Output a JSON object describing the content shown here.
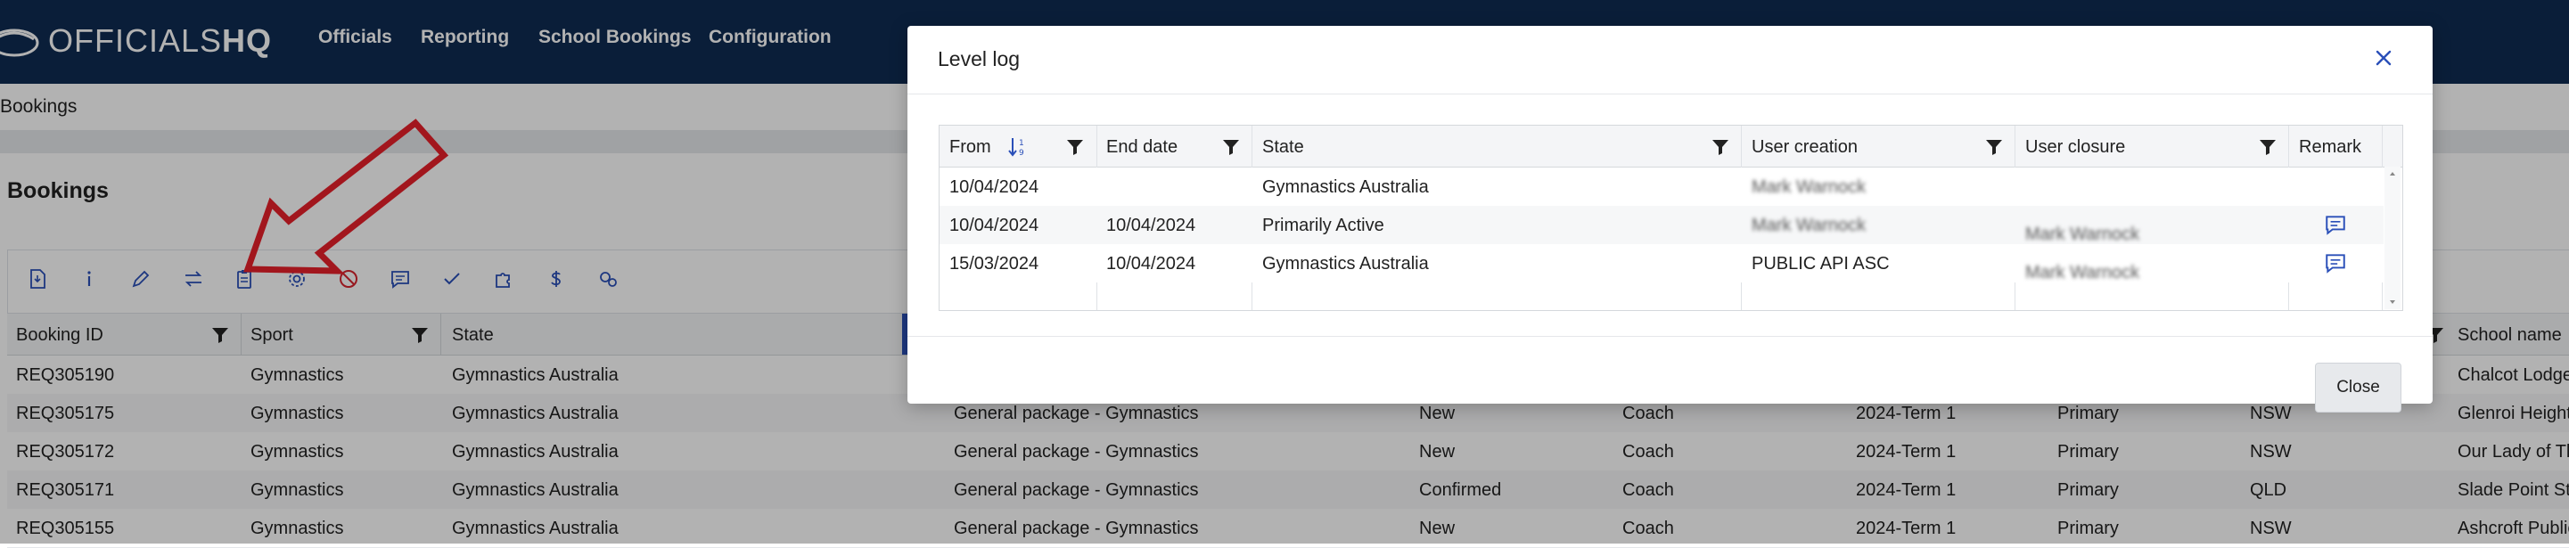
{
  "app": {
    "logo_prefix": "OFFICIALS",
    "logo_suffix": "HQ"
  },
  "nav": {
    "items": [
      "Officials",
      "Reporting",
      "School Bookings",
      "Configuration"
    ]
  },
  "breadcrumb": "Bookings",
  "page_title": "Bookings",
  "toolbar_icons": [
    "export-icon",
    "info-icon",
    "edit-icon",
    "transfer-icon",
    "clipboard-icon",
    "gear-icon",
    "cancel-icon",
    "comment-icon",
    "check-icon",
    "puzzle-icon",
    "dollar-icon",
    "settings-link-icon"
  ],
  "table": {
    "columns": [
      "Booking ID",
      "Sport",
      "State",
      "School name"
    ],
    "rows": [
      {
        "id": "REQ305190",
        "sport": "Gymnastics",
        "state": "Gymnastics Australia",
        "package": "",
        "status": "",
        "role": "",
        "term": "",
        "level": "",
        "region": "",
        "school": "Chalcot Lodge"
      },
      {
        "id": "REQ305175",
        "sport": "Gymnastics",
        "state": "Gymnastics Australia",
        "package": "General package - Gymnastics",
        "status": "New",
        "role": "Coach",
        "term": "2024-Term 1",
        "level": "Primary",
        "region": "NSW",
        "school": "Glenroi Height"
      },
      {
        "id": "REQ305172",
        "sport": "Gymnastics",
        "state": "Gymnastics Australia",
        "package": "General package - Gymnastics",
        "status": "New",
        "role": "Coach",
        "term": "2024-Term 1",
        "level": "Primary",
        "region": "NSW",
        "school": "Our Lady of Th"
      },
      {
        "id": "REQ305171",
        "sport": "Gymnastics",
        "state": "Gymnastics Australia",
        "package": "General package - Gymnastics",
        "status": "Confirmed",
        "role": "Coach",
        "term": "2024-Term 1",
        "level": "Primary",
        "region": "QLD",
        "school": "Slade Point Sta"
      },
      {
        "id": "REQ305155",
        "sport": "Gymnastics",
        "state": "Gymnastics Australia",
        "package": "General package - Gymnastics",
        "status": "New",
        "role": "Coach",
        "term": "2024-Term 1",
        "level": "Primary",
        "region": "NSW",
        "school": "Ashcroft Public"
      }
    ]
  },
  "modal": {
    "title": "Level log",
    "columns": [
      "From",
      "End date",
      "State",
      "User creation",
      "User closure",
      "Remark"
    ],
    "rows": [
      {
        "from": "10/04/2024",
        "end": "",
        "state": "Gymnastics Australia",
        "creator": "Mark Warnock",
        "closer": "",
        "remark": false
      },
      {
        "from": "10/04/2024",
        "end": "10/04/2024",
        "state": "Primarily Active",
        "creator": "Mark Warnock",
        "closer": "Mark Warnock",
        "remark": true
      },
      {
        "from": "15/03/2024",
        "end": "10/04/2024",
        "state": "Gymnastics Australia",
        "creator": "PUBLIC API ASC",
        "closer": "Mark Warnock",
        "remark": true
      }
    ],
    "close_label": "Close"
  },
  "colors": {
    "nav_bg": "#0f2b52",
    "accent": "#2a4fb8",
    "annotation_arrow": "#e8202a"
  }
}
